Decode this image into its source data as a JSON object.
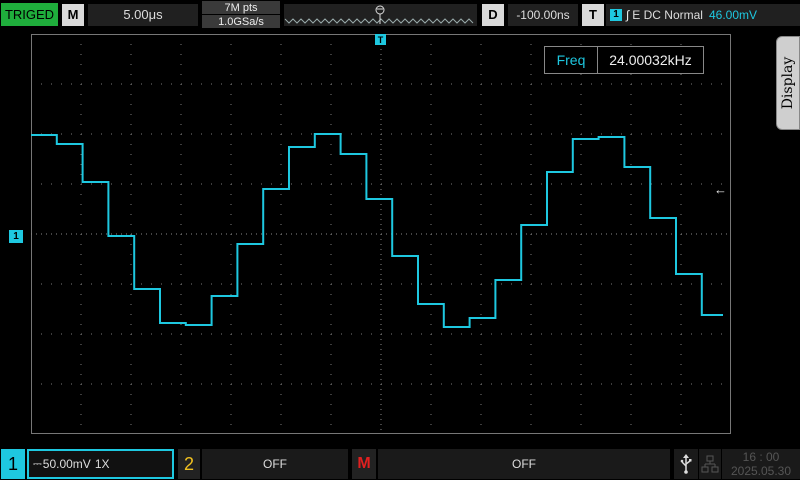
{
  "header": {
    "trigger_status": "TRIGED",
    "main_key": "M",
    "timebase": "5.00μs",
    "memory_depth": "7M pts",
    "sample_rate": "1.0GSa/s",
    "delay_key": "D",
    "delay": "-100.00ns",
    "trigger_key": "T",
    "trigger_channel": "1",
    "trigger_edge": "∫",
    "trigger_mode": "E DC Normal",
    "trigger_level": "46.00mV"
  },
  "measurement": {
    "label": "Freq",
    "value": "24.00032kHz"
  },
  "side_menu": {
    "display_tab": "Display"
  },
  "markers": {
    "ch1_ground": "1",
    "trigger_position": "T",
    "trigger_level_arrow": "←"
  },
  "footer": {
    "ch1": {
      "number": "1",
      "coupling_icon": "⎓",
      "scale": "50.00mV",
      "probe": "1X"
    },
    "ch2": {
      "number": "2",
      "status": "OFF"
    },
    "math": {
      "label": "M",
      "status": "OFF"
    },
    "time": "16 : 00",
    "date": "2025.05.30"
  },
  "colors": {
    "ch1": "#1ec8e0",
    "ch2": "#f0c020",
    "math": "#e02020",
    "triged": "#1fae3c"
  },
  "icons": [
    "usb-icon",
    "network-icon"
  ]
}
